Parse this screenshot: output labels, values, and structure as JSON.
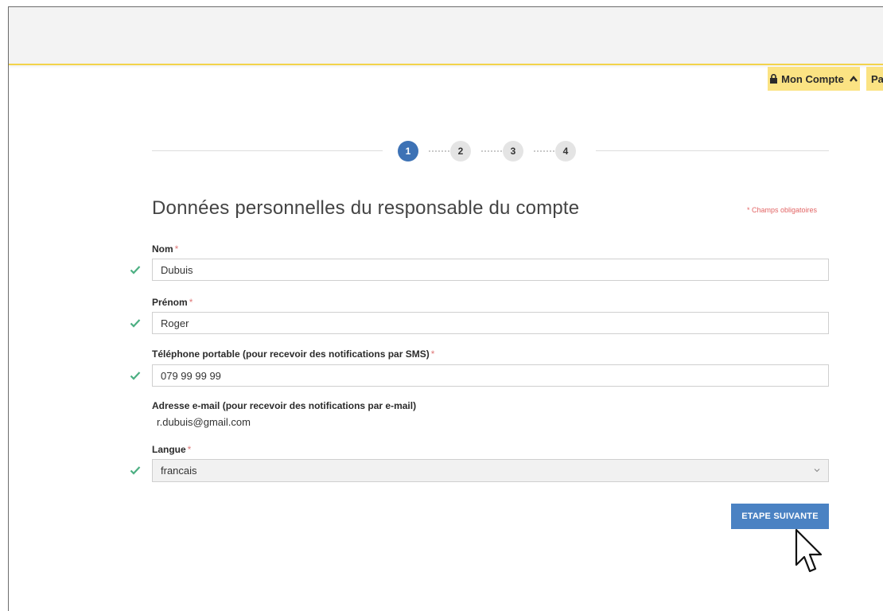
{
  "header": {
    "account_label": "Mon Compte",
    "second_label": "Pa"
  },
  "stepper": {
    "steps": [
      "1",
      "2",
      "3",
      "4"
    ],
    "active": 1
  },
  "form": {
    "title": "Données personnelles du responsable du compte",
    "required_note": "* Champs obligatoires",
    "required_mark": "*",
    "fields": {
      "nom": {
        "label": "Nom",
        "value": "Dubuis"
      },
      "prenom": {
        "label": "Prénom",
        "value": "Roger"
      },
      "phone": {
        "label": "Téléphone portable (pour recevoir des notifications par SMS)",
        "value": "079 99 99 99"
      },
      "email": {
        "label": "Adresse e-mail (pour recevoir des notifications par e-mail)",
        "value": "r.dubuis@gmail.com"
      },
      "langue": {
        "label": "Langue",
        "value": "francais"
      }
    },
    "next_button": "ETAPE SUIVANTE"
  },
  "colors": {
    "accent_blue": "#3d72b5",
    "button_blue": "#4a82c3",
    "header_yellow": "#fbe383",
    "check_green": "#4caf82",
    "required_red": "#e26464"
  },
  "icons": {
    "lock": "lock-icon",
    "chevron_up": "chevron-up-icon",
    "check": "check-icon",
    "chevron_down": "chevron-down-icon",
    "cursor": "mouse-pointer-icon"
  }
}
